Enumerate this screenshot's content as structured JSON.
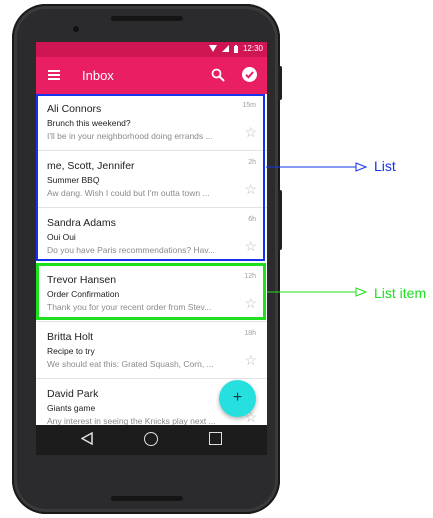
{
  "statusbar": {
    "time": "12:30"
  },
  "appbar": {
    "title": "Inbox"
  },
  "emails": [
    {
      "sender": "Ali Connors",
      "subject": "Brunch this weekend?",
      "preview": "I'll be in your neighborhood doing errands ...",
      "time": "15m"
    },
    {
      "sender": "me, Scott, Jennifer",
      "subject": "Summer BBQ",
      "preview": "Aw dang. Wish I could but I'm outta town ...",
      "time": "2h"
    },
    {
      "sender": "Sandra Adams",
      "subject": "Oui Oui",
      "preview": "Do you have Paris recommendations? Hav...",
      "time": "6h"
    },
    {
      "sender": "Trevor Hansen",
      "subject": "Order Confirmation",
      "preview": "Thank you for your recent order from Stev...",
      "time": "12h"
    },
    {
      "sender": "Britta Holt",
      "subject": "Recipe to try",
      "preview": "We should eat this: Grated Squash, Corn, ...",
      "time": "18h"
    },
    {
      "sender": "David Park",
      "subject": "Giants game",
      "preview": "Any interest in seeing the Knicks play next ...",
      "time": ""
    }
  ],
  "fab": {
    "label": "+"
  },
  "callouts": {
    "list": "List",
    "list_item": "List item"
  },
  "colors": {
    "primary": "#e91e63",
    "primary_dark": "#d01553",
    "fab": "#26e0e0",
    "list_highlight": "#1533ee",
    "item_highlight": "#1ee01e"
  }
}
